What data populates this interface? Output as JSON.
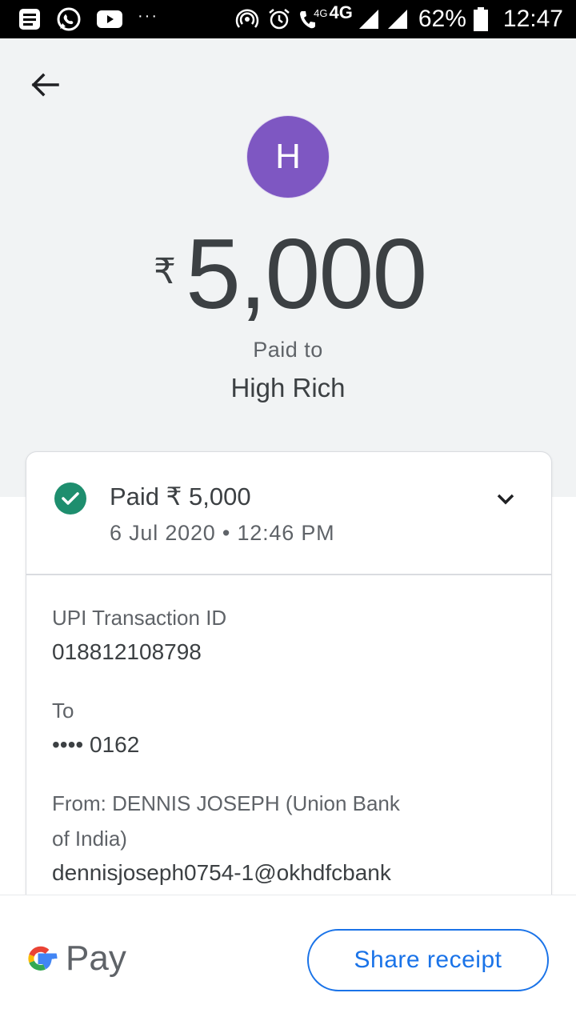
{
  "status_bar": {
    "battery": "62%",
    "time": "12:47",
    "network_small": "4G",
    "network": "4G",
    "overflow": "···",
    "icons": [
      "news-icon",
      "whatsapp-icon",
      "youtube-icon",
      "hotspot-icon",
      "alarm-icon",
      "call-icon",
      "signal-icon",
      "battery-icon"
    ]
  },
  "header": {
    "avatar_initial": "H",
    "currency_symbol": "₹",
    "amount": "5,000",
    "paid_to_label": "Paid to",
    "payee_name": "High Rich"
  },
  "card": {
    "status": "Paid ₹ 5,000",
    "datetime": "6 Jul 2020 • 12:46 PM",
    "details": {
      "upi_label": "UPI Transaction ID",
      "upi_value": "018812108798",
      "to_label": "To",
      "to_value": "•••• 0162",
      "from_label_line1": "From: DENNIS JOSEPH (Union Bank",
      "from_label_line2": "of India)",
      "from_value": "dennisjoseph0754-1@okhdfcbank"
    }
  },
  "bottom": {
    "brand_text": "Pay",
    "share_label": "Share receipt"
  },
  "colors": {
    "avatar": "#7e57c2",
    "success": "#1e8e6e",
    "accent": "#1a73e8",
    "hero_bg": "#f1f3f4"
  }
}
